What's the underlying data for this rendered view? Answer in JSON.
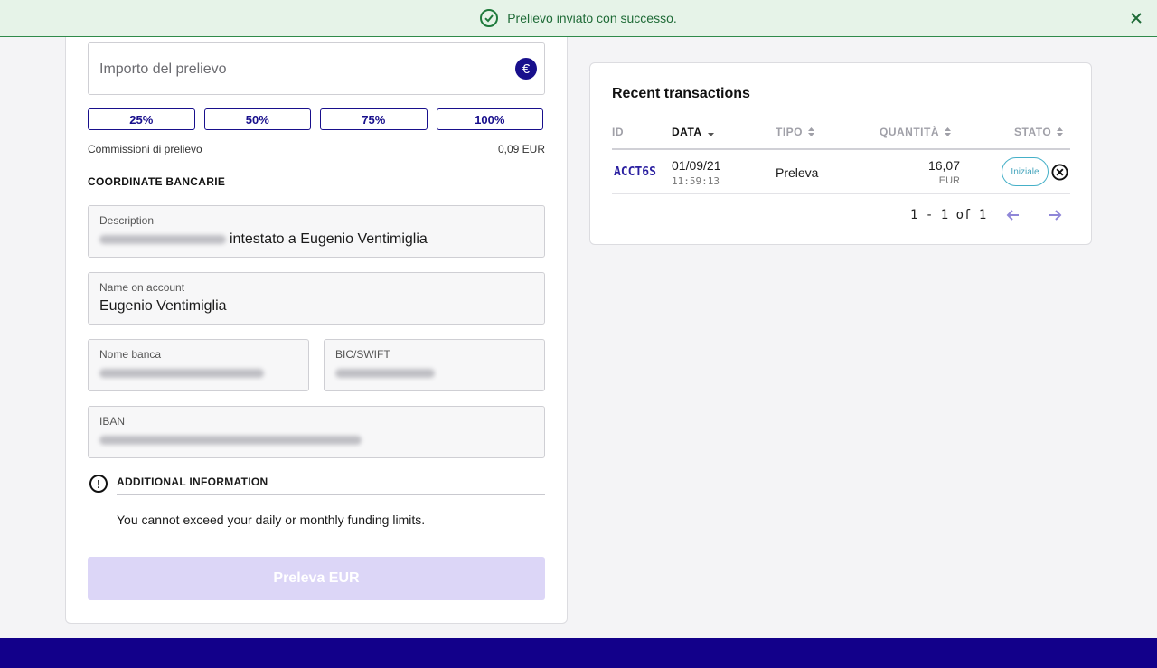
{
  "toast": {
    "message": "Prelievo inviato con successo.",
    "icon": "check-circle-icon",
    "close_icon": "close-icon"
  },
  "withdraw_form": {
    "amount_placeholder": "Importo del prelievo",
    "currency_symbol": "€",
    "percent_buttons": [
      "25%",
      "50%",
      "75%",
      "100%"
    ],
    "fee_label": "Commissioni di prelievo",
    "fee_value": "0,09 EUR",
    "bank_section_title": "COORDINATE BANCARIE",
    "description_label": "Description",
    "description_value": "intestato a Eugenio Ventimiglia",
    "name_label": "Name on account",
    "name_value": "Eugenio Ventimiglia",
    "bank_name_label": "Nome banca",
    "bic_label": "BIC/SWIFT",
    "iban_label": "IBAN",
    "info_title": "ADDITIONAL INFORMATION",
    "info_text": "You cannot exceed your daily or monthly funding limits.",
    "submit_label": "Preleva EUR"
  },
  "transactions": {
    "title": "Recent transactions",
    "columns": [
      "ID",
      "DATA",
      "TIPO",
      "QUANTITÀ",
      "STATO"
    ],
    "rows": [
      {
        "id": "ACCT6S",
        "date": "01/09/21",
        "time": "11:59:13",
        "type": "Preleva",
        "amount": "16,07",
        "currency": "EUR",
        "status": "Iniziale"
      }
    ],
    "pagination": "1 - 1 of 1"
  },
  "colors": {
    "brand": "#12008a",
    "success": "#1f7a3c",
    "status_initial": "#45b0c8"
  }
}
